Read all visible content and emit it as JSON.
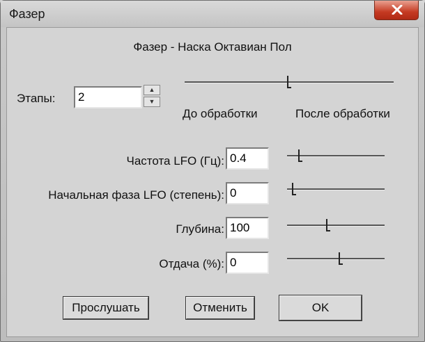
{
  "window": {
    "title": "Фазер"
  },
  "dialog": {
    "heading": "Фазер - Наска Октавиан Пол",
    "stages": {
      "label": "Этапы:",
      "value": "2"
    },
    "mix": {
      "left_label": "До обработки",
      "right_label": "После обработки",
      "position": 0.5
    },
    "params": [
      {
        "label": "Частота LFO (Гц):",
        "value": "0.4",
        "slider_position": 0.12
      },
      {
        "label": "Начальная фаза LFO (степень):",
        "value": "0",
        "slider_position": 0.05
      },
      {
        "label": "Глубина:",
        "value": "100",
        "slider_position": 0.42
      },
      {
        "label": "Отдача (%):",
        "value": "0",
        "slider_position": 0.55
      }
    ],
    "buttons": {
      "preview": "Прослушать",
      "cancel": "Отменить",
      "ok": "OK"
    }
  }
}
